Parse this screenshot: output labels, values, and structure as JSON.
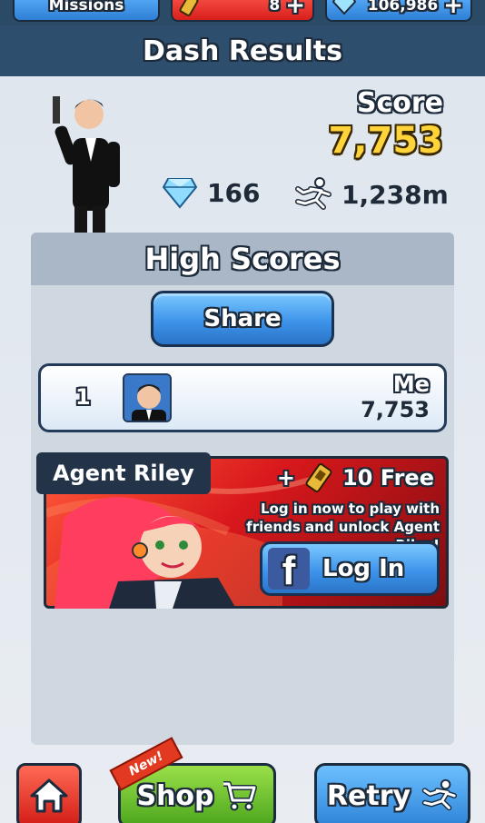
{
  "topbar": {
    "missions_label": "Missions",
    "keys_count": "8",
    "gems_count": "106,986",
    "plus": "+"
  },
  "header": {
    "title": "Dash Results"
  },
  "results": {
    "score_label": "Score",
    "score_value": "7,753",
    "gems": "166",
    "distance": "1,238m"
  },
  "high_scores": {
    "title": "High Scores",
    "share_label": "Share",
    "rows": [
      {
        "rank": "1",
        "name": "Me",
        "score": "7,753"
      }
    ]
  },
  "promo": {
    "character": "Agent Riley",
    "reward": "+",
    "reward_text": "10 Free",
    "message": "Log in now to play with friends and unlock Agent Riley!",
    "login_label": "Log In",
    "fb_letter": "f"
  },
  "bottom": {
    "shop_label": "Shop",
    "new_badge": "New!",
    "retry_label": "Retry"
  },
  "colors": {
    "header_bg": "#2e4e6d",
    "score_gold": "#ffd33a",
    "button_blue": "#3d94ea",
    "shop_green": "#4da61d",
    "home_red": "#d31d17",
    "facebook_blue": "#3b5aa0"
  }
}
